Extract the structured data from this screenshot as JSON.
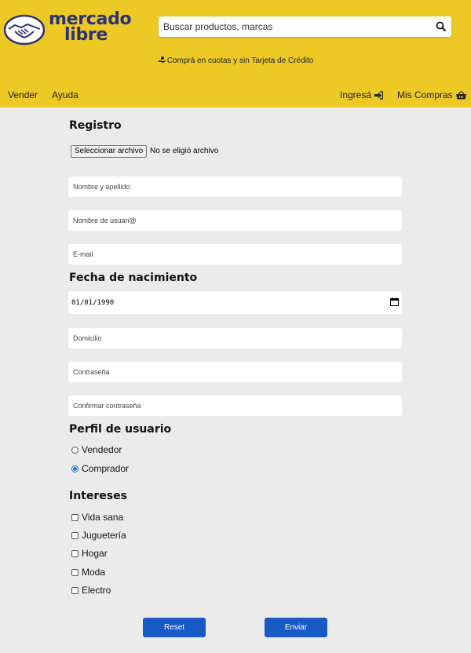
{
  "header": {
    "logo": {
      "line1": "mercado",
      "line2": "libre"
    },
    "search": {
      "placeholder": "Buscar productos, marcas",
      "value": ""
    },
    "promo": "Comprá en cuotas y sin Tarjeta de Crédito",
    "nav": {
      "vender": "Vender",
      "ayuda": "Ayuda",
      "ingresa": "Ingresá",
      "mis_compras": "Mis Compras"
    },
    "icons": {
      "search": "search-icon",
      "promo": "hand-money-icon",
      "login": "sign-in-icon",
      "cart": "basket-icon"
    },
    "colors": {
      "background": "#ecc925",
      "logo_text": "#2d3277"
    }
  },
  "form": {
    "title": "Registro",
    "file": {
      "button_label": "Seleccionar archivo",
      "status": "No se eligió archivo"
    },
    "fields": {
      "nombre": {
        "placeholder": "Nombre y apellido"
      },
      "usuario": {
        "placeholder": "Nombre de usuari@"
      },
      "email": {
        "placeholder": "E-mail"
      },
      "domicilio": {
        "placeholder": "Domicilio"
      },
      "password": {
        "placeholder": "Contraseña"
      },
      "password_confirm": {
        "placeholder": "Confirmar contraseña"
      }
    },
    "birth": {
      "label": "Fecha de nacimiento",
      "value": "01/01/1990"
    },
    "profile": {
      "label": "Perfil de usuario",
      "options": [
        {
          "label": "Vendedor",
          "selected": false
        },
        {
          "label": "Comprador",
          "selected": true
        }
      ]
    },
    "interests": {
      "label": "Intereses",
      "options": [
        {
          "label": "Vida sana",
          "checked": false
        },
        {
          "label": "Juguetería",
          "checked": false
        },
        {
          "label": "Hogar",
          "checked": false
        },
        {
          "label": "Moda",
          "checked": false
        },
        {
          "label": "Electro",
          "checked": false
        }
      ]
    },
    "buttons": {
      "reset": "Reset",
      "submit": "Enviar"
    },
    "colors": {
      "page_bg": "#ebebeb",
      "button": "#1759c5",
      "radio_selected": "#1a73e8"
    }
  }
}
